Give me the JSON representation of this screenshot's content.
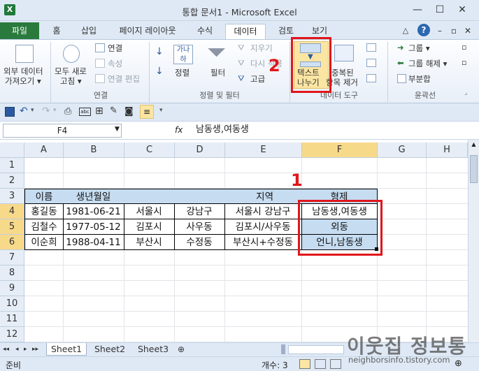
{
  "window": {
    "title": "통합 문서1 - Microsoft Excel",
    "app_icon": "X",
    "minimize": "—",
    "maximize": "☐",
    "close": "✕"
  },
  "tabs": [
    {
      "label": "파일"
    },
    {
      "label": "홈"
    },
    {
      "label": "삽입"
    },
    {
      "label": "페이지 레이아웃"
    },
    {
      "label": "수식"
    },
    {
      "label": "데이터"
    },
    {
      "label": "검토"
    },
    {
      "label": "보기"
    }
  ],
  "ribbon": {
    "get_external_line1": "외부 데이터",
    "get_external_line2": "가져오기 ▾",
    "refresh_all_line1": "모두 새로",
    "refresh_all_line2": "고침 ▾",
    "connections": "연결",
    "properties": "속성",
    "edit_links": "연결 편집",
    "group_connections": "연결",
    "sort_asc": "↓",
    "sort_label": "정렬",
    "filter": "필터",
    "clear": "지우기",
    "reapply": "다시 적용",
    "advanced": "고급",
    "group_sort_filter": "정렬 및 필터",
    "text_to_columns_line1": "텍스트",
    "text_to_columns_line2": "나누기",
    "remove_duplicates_line1": "중복된",
    "remove_duplicates_line2": "항목 제거",
    "group_data_tools": "데이터 도구",
    "group_btn": "그룹 ▾",
    "ungroup_btn": "그룹 해제 ▾",
    "subtotal": "부분합",
    "group_outline": "윤곽선"
  },
  "formula_bar": {
    "name_box": "F4",
    "fx": "fx",
    "formula": "남동생,여동생"
  },
  "columns": [
    "A",
    "B",
    "C",
    "D",
    "E",
    "F",
    "G",
    "H"
  ],
  "rows": [
    "1",
    "2",
    "3",
    "4",
    "5",
    "6",
    "7",
    "8",
    "9",
    "10",
    "11",
    "12"
  ],
  "table": {
    "headers": [
      "이름",
      "생년월일",
      "",
      "",
      "지역",
      "형제"
    ],
    "data": [
      [
        "홍길동",
        "1981-06-21",
        "서울시",
        "강남구",
        "서울시 강남구",
        "남동생,여동생"
      ],
      [
        "김철수",
        "1977-05-12",
        "김포시",
        "사우동",
        "김포시/사우동",
        "외동"
      ],
      [
        "이순희",
        "1988-04-11",
        "부산시",
        "수정동",
        "부산시+수정동",
        "언니,남동생"
      ]
    ]
  },
  "sheets": [
    "Sheet1",
    "Sheet2",
    "Sheet3"
  ],
  "status": {
    "ready": "준비",
    "count": "개수: 3"
  },
  "annotations": {
    "step1": "1",
    "step2": "2",
    "highlight_color": "#e0161a"
  },
  "watermark": {
    "text": "이웃집 정보통",
    "url": "neighborsinfo.tistory.com"
  }
}
